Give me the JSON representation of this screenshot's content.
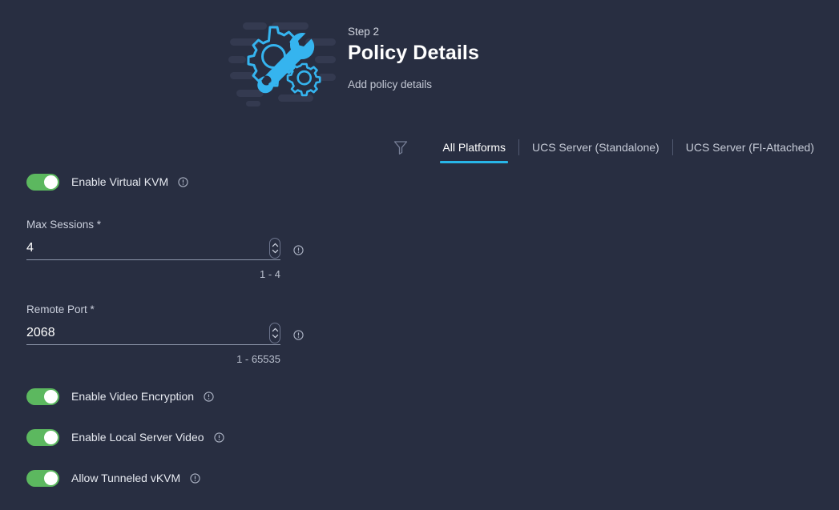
{
  "theme": {
    "background": "#282e41",
    "accent": "#28b6e8",
    "toggle_on": "#5cb85f",
    "illustration_primary": "#35b4ef",
    "illustration_muted": "#343a50",
    "text_primary": "#ffffff",
    "text_secondary": "#c5cad6",
    "underline": "#8e96ab"
  },
  "header": {
    "step": "Step 2",
    "title": "Policy Details",
    "subtitle": "Add policy details",
    "illustration_name": "gear-wrench-illustration"
  },
  "tabs": {
    "filter_icon": "filter-funnel-icon",
    "items": [
      {
        "label": "All Platforms",
        "active": true
      },
      {
        "label": "UCS Server (Standalone)",
        "active": false
      },
      {
        "label": "UCS Server (FI-Attached)",
        "active": false
      }
    ]
  },
  "form": {
    "enable_virtual_kvm": {
      "label": "Enable Virtual KVM",
      "state": "on",
      "info_icon": "info-circle-icon"
    },
    "max_sessions": {
      "label": "Max Sessions *",
      "value": "4",
      "helper": "1 - 4",
      "info_icon": "info-circle-icon",
      "stepper_icon": "stepper-up-down-icon"
    },
    "remote_port": {
      "label": "Remote Port *",
      "value": "2068",
      "helper": "1 - 65535",
      "info_icon": "info-circle-icon",
      "stepper_icon": "stepper-up-down-icon"
    },
    "enable_video_encryption": {
      "label": "Enable Video Encryption",
      "state": "on",
      "info_icon": "info-circle-icon"
    },
    "enable_local_server_video": {
      "label": "Enable Local Server Video",
      "state": "on",
      "info_icon": "info-circle-icon"
    },
    "allow_tunneled_vkvm": {
      "label": "Allow Tunneled vKVM",
      "state": "on",
      "info_icon": "info-circle-icon"
    }
  }
}
